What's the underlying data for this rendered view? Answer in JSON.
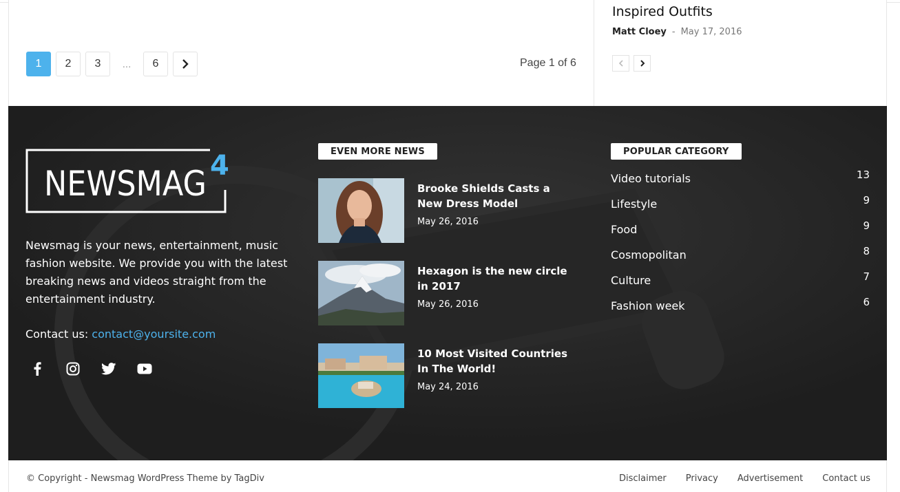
{
  "pagination": {
    "pages": [
      "1",
      "2",
      "3",
      "6"
    ],
    "dots": "...",
    "page_of": "Page 1 of 6"
  },
  "sidebar_post": {
    "title": "Inspired Outfits",
    "author": "Matt Cloey",
    "separator": "-",
    "date": "May 17, 2016"
  },
  "footer": {
    "logo_text": "NEWSMAG",
    "logo_number": "4",
    "about": "Newsmag is your news, entertainment, music fashion website. We provide you with the latest breaking news and videos straight from the entertainment industry.",
    "contact_label": "Contact us:",
    "contact_email": "contact@yoursite.com",
    "socials": [
      "facebook-icon",
      "instagram-icon",
      "twitter-icon",
      "youtube-icon"
    ],
    "even_more_news": {
      "title": "EVEN MORE NEWS",
      "items": [
        {
          "title": "Brooke Shields Casts a New Dress Model",
          "date": "May 26, 2016"
        },
        {
          "title": "Hexagon is the new circle in 2017",
          "date": "May 26, 2016"
        },
        {
          "title": "10 Most Visited Countries In The World!",
          "date": "May 24, 2016"
        }
      ]
    },
    "popular_category": {
      "title": "POPULAR CATEGORY",
      "items": [
        {
          "name": "Video tutorials",
          "count": "13"
        },
        {
          "name": "Lifestyle",
          "count": "9"
        },
        {
          "name": "Food",
          "count": "9"
        },
        {
          "name": "Cosmopolitan",
          "count": "8"
        },
        {
          "name": "Culture",
          "count": "7"
        },
        {
          "name": "Fashion week",
          "count": "6"
        }
      ]
    }
  },
  "subfooter": {
    "copyright": "© Copyright - Newsmag WordPress Theme by TagDiv",
    "menu": [
      "Disclaimer",
      "Privacy",
      "Advertisement",
      "Contact us"
    ]
  },
  "colors": {
    "accent": "#4db2ec",
    "footer_bg": "#232323"
  }
}
